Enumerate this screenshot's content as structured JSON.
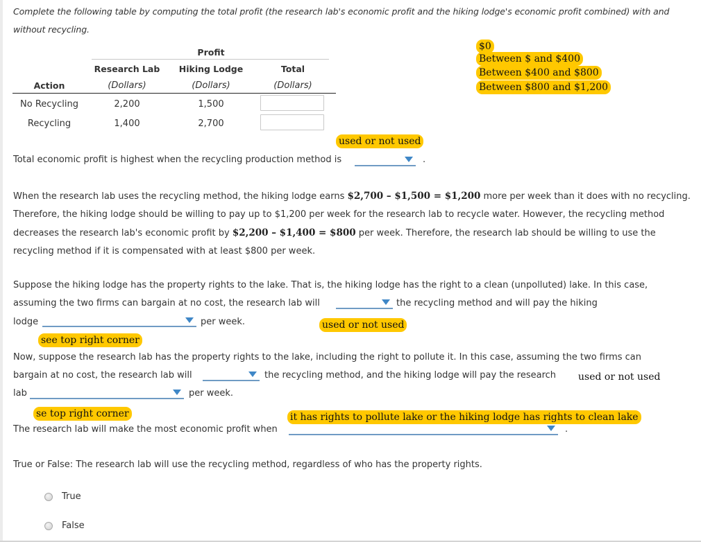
{
  "intro": "Complete the following table by computing the total profit (the research lab's economic profit and the hiking lodge's economic profit combined) with and without recycling.",
  "table": {
    "group_header": "Profit",
    "columns": [
      {
        "label": "Action",
        "unit": ""
      },
      {
        "label": "Research Lab",
        "unit": "(Dollars)"
      },
      {
        "label": "Hiking Lodge",
        "unit": "(Dollars)"
      },
      {
        "label": "Total",
        "unit": "(Dollars)"
      }
    ],
    "rows": [
      {
        "action": "No Recycling",
        "research_lab": "2,200",
        "hiking_lodge": "1,500",
        "total": ""
      },
      {
        "action": "Recycling",
        "research_lab": "1,400",
        "hiking_lodge": "2,700",
        "total": ""
      }
    ]
  },
  "annotations": {
    "options_list": [
      "$0",
      "Between $ and $400",
      "Between $400 and $800",
      "Between $800 and $1,200"
    ],
    "used_or_not_1": "used or not used",
    "used_or_not_2": "used or not used",
    "see_corner_1": "see top right corner",
    "used_or_not_3": "used or not used",
    "see_corner_2": "se top right corner",
    "rights_note": "it has rights to pollute lake or the hiking lodge has rights to clean lake"
  },
  "q1": {
    "text": "Total economic profit is highest when the recycling production method is",
    "dropdown_value": "",
    "suffix": "."
  },
  "explanation": {
    "part1": "When the research lab uses the recycling method, the hiking lodge earns ",
    "math1": "$2,700 – $1,500 = $1,200",
    "part2": " more per week than it does with no recycling. Therefore, the hiking lodge should be willing to pay up to $1,200 per week for the research lab to recycle water. However, the recycling method decreases the research lab's economic profit by ",
    "math2": "$2,200 – $1,400 = $800",
    "part3": " per week. Therefore, the research lab should be willing to use the recycling method if it is compensated with at least $800 per week."
  },
  "q2": {
    "line1": "Suppose the hiking lodge has the property rights to the lake. That is, the hiking lodge has the right to a clean (unpolluted) lake. In this case,",
    "line2_pre": "assuming the two firms can bargain at no cost, the research lab will",
    "line2_post": "the recycling method and will pay the hiking",
    "line3_pre": "lodge",
    "line3_post": "per week.",
    "dropdown_method_value": "",
    "dropdown_amount_value": ""
  },
  "q3": {
    "line1": "Now, suppose the research lab has the property rights to the lake, including the right to pollute it. In this case, assuming the two firms can",
    "line2_pre": "bargain at no cost, the research lab will",
    "line2_post": "the recycling method, and the hiking lodge will pay the research",
    "line3_pre": "lab",
    "line3_post": "per week.",
    "dropdown_method_value": "",
    "dropdown_amount_value": ""
  },
  "q4": {
    "text": "The research lab will make the most economic profit when",
    "dropdown_value": "",
    "suffix": "."
  },
  "q5": {
    "text": "True or False: The research lab will use the recycling method, regardless of who has the property rights.",
    "options": [
      "True",
      "False"
    ],
    "selected": null
  }
}
